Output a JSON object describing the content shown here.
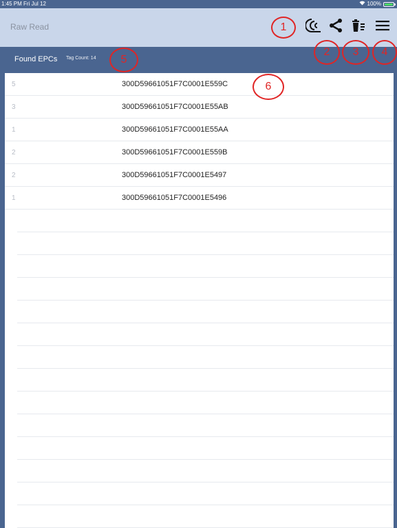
{
  "status_bar": {
    "time": "1:45 PM  Fri Jul 12",
    "wifi": "wifi-icon",
    "battery_text": "100%",
    "battery_color": "#4cd964"
  },
  "nav": {
    "title": "Raw Read"
  },
  "actions": [
    {
      "name": "scan-toggle-button",
      "icon": "scan-waves-icon"
    },
    {
      "name": "share-button",
      "icon": "share-icon"
    },
    {
      "name": "clear-list-button",
      "icon": "trash-list-icon"
    },
    {
      "name": "menu-button",
      "icon": "hamburger-menu-icon"
    }
  ],
  "annotations": [
    "1",
    "2",
    "3",
    "4",
    "5",
    "6"
  ],
  "list_header": {
    "label": "Found EPCs",
    "tag_count": "Tag Count: 14"
  },
  "epc_rows": [
    {
      "count": "5",
      "epc": "300D59661051F7C0001E559C"
    },
    {
      "count": "3",
      "epc": "300D59661051F7C0001E55AB"
    },
    {
      "count": "1",
      "epc": "300D59661051F7C0001E55AA"
    },
    {
      "count": "2",
      "epc": "300D59661051F7C0001E559B"
    },
    {
      "count": "2",
      "epc": "300D59661051F7C0001E5497"
    },
    {
      "count": "1",
      "epc": "300D59661051F7C0001E5496"
    }
  ],
  "colors": {
    "header_bg": "#4a6590",
    "nav_bg": "#c9d6ea",
    "callout": "#e02525"
  }
}
